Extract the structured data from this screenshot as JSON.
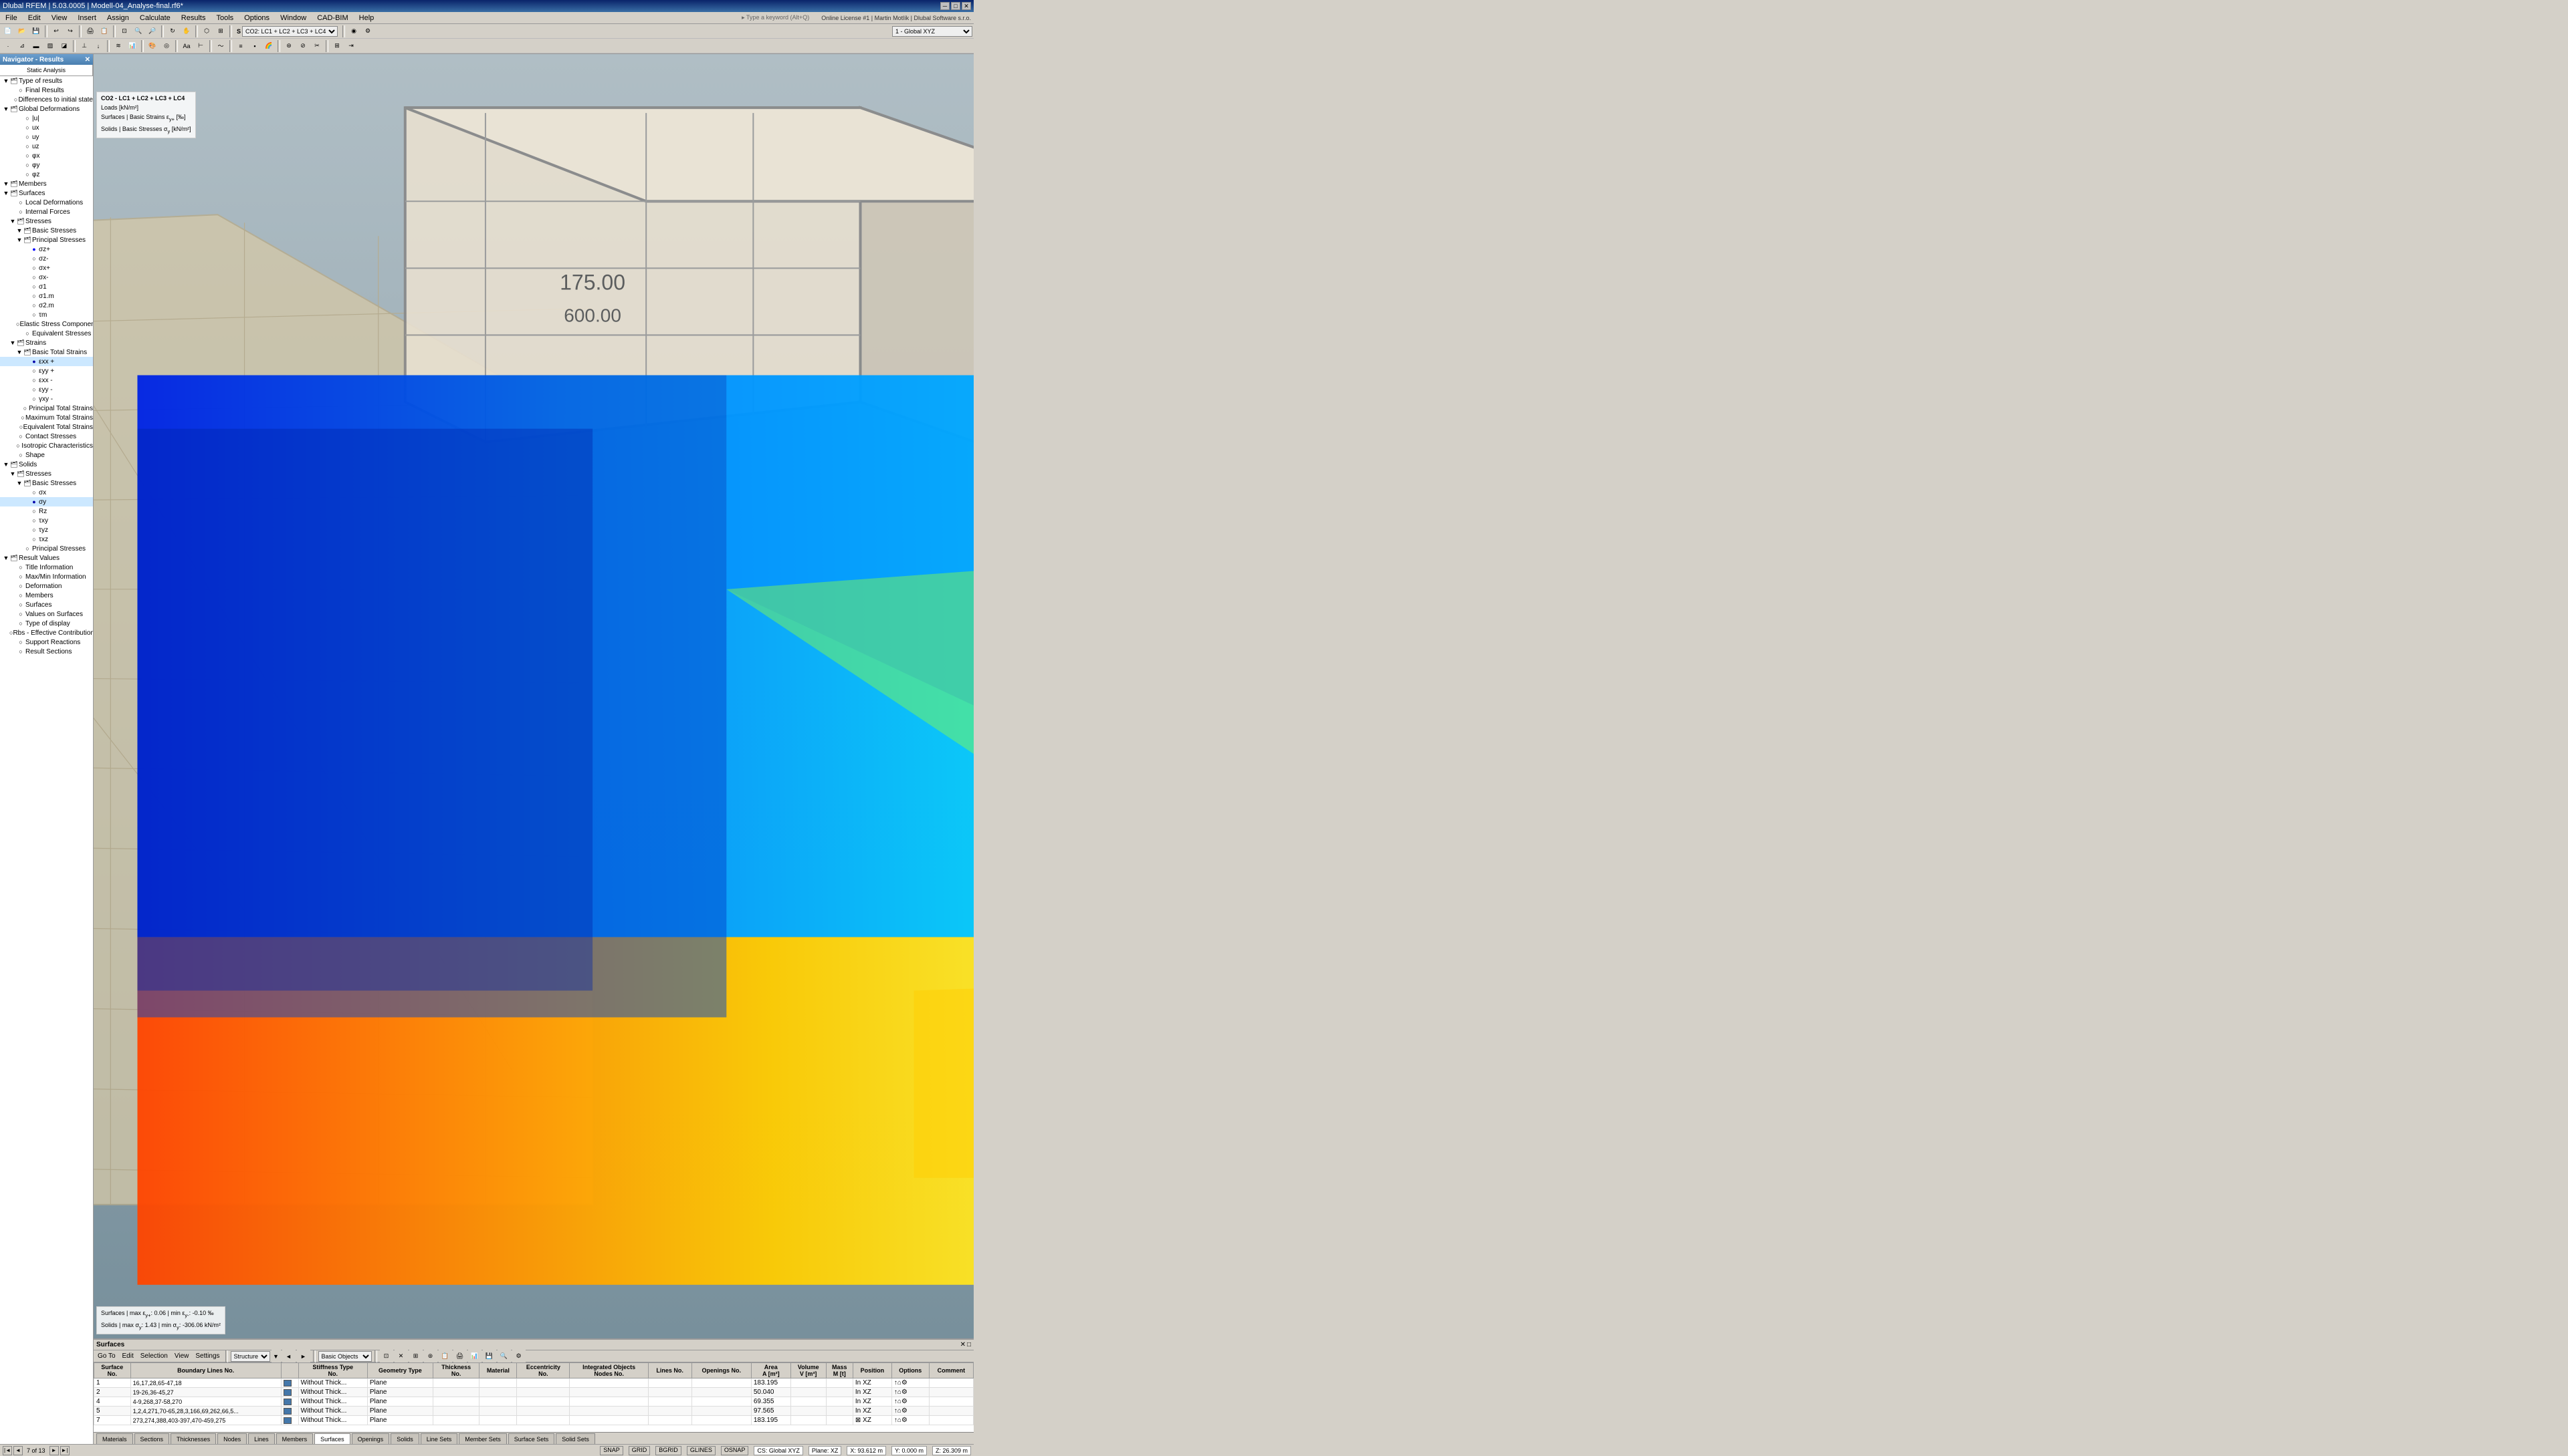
{
  "titleBar": {
    "title": "Dlubal RFEM | 5.03.0005 | Modell-04_Analyse-final.rf6*",
    "minimize": "─",
    "maximize": "□",
    "close": "✕"
  },
  "menuBar": {
    "items": [
      "File",
      "Edit",
      "View",
      "Insert",
      "Assign",
      "Calculate",
      "Results",
      "Tools",
      "Options",
      "Window",
      "CAD-BIM",
      "Help"
    ]
  },
  "navigator": {
    "title": "Navigator - Results",
    "tabs": [
      "Static Analysis"
    ],
    "tree": [
      {
        "label": "Type of results",
        "level": 0,
        "icon": "▼",
        "toggle": "▼"
      },
      {
        "label": "Final Results",
        "level": 1,
        "icon": "○",
        "toggle": ""
      },
      {
        "label": "Differences to initial state",
        "level": 1,
        "icon": "○",
        "toggle": ""
      },
      {
        "label": "Global Deformations",
        "level": 0,
        "icon": "▼",
        "toggle": "▼"
      },
      {
        "label": "|u|",
        "level": 2,
        "icon": "○",
        "toggle": ""
      },
      {
        "label": "ux",
        "level": 2,
        "icon": "○",
        "toggle": ""
      },
      {
        "label": "uy",
        "level": 2,
        "icon": "○",
        "toggle": ""
      },
      {
        "label": "uz",
        "level": 2,
        "icon": "○",
        "toggle": ""
      },
      {
        "label": "φx",
        "level": 2,
        "icon": "○",
        "toggle": ""
      },
      {
        "label": "φy",
        "level": 2,
        "icon": "○",
        "toggle": ""
      },
      {
        "label": "φz",
        "level": 2,
        "icon": "○",
        "toggle": ""
      },
      {
        "label": "Members",
        "level": 0,
        "icon": "▼",
        "toggle": "▼"
      },
      {
        "label": "Surfaces",
        "level": 0,
        "icon": "▼",
        "toggle": "▼"
      },
      {
        "label": "Local Deformations",
        "level": 1,
        "icon": "○",
        "toggle": ""
      },
      {
        "label": "Internal Forces",
        "level": 1,
        "icon": "○",
        "toggle": ""
      },
      {
        "label": "Stresses",
        "level": 1,
        "icon": "▼",
        "toggle": "▼"
      },
      {
        "label": "Basic Stresses",
        "level": 2,
        "icon": "▼",
        "toggle": "▼"
      },
      {
        "label": "Principal Stresses",
        "level": 2,
        "icon": "▼",
        "toggle": "▼"
      },
      {
        "label": "σz+",
        "level": 3,
        "icon": "●",
        "toggle": ""
      },
      {
        "label": "σz-",
        "level": 3,
        "icon": "○",
        "toggle": ""
      },
      {
        "label": "σx+",
        "level": 3,
        "icon": "○",
        "toggle": ""
      },
      {
        "label": "σx-",
        "level": 3,
        "icon": "○",
        "toggle": ""
      },
      {
        "label": "σ1",
        "level": 3,
        "icon": "○",
        "toggle": ""
      },
      {
        "label": "σ1.m",
        "level": 3,
        "icon": "○",
        "toggle": ""
      },
      {
        "label": "σ2.m",
        "level": 3,
        "icon": "○",
        "toggle": ""
      },
      {
        "label": "τm",
        "level": 3,
        "icon": "○",
        "toggle": ""
      },
      {
        "label": "Elastic Stress Components",
        "level": 2,
        "icon": "○",
        "toggle": ""
      },
      {
        "label": "Equivalent Stresses",
        "level": 2,
        "icon": "○",
        "toggle": ""
      },
      {
        "label": "Strains",
        "level": 1,
        "icon": "▼",
        "toggle": "▼"
      },
      {
        "label": "Basic Total Strains",
        "level": 2,
        "icon": "▼",
        "toggle": "▼"
      },
      {
        "label": "εxx +",
        "level": 3,
        "icon": "●",
        "toggle": ""
      },
      {
        "label": "εyy +",
        "level": 3,
        "icon": "○",
        "toggle": ""
      },
      {
        "label": "εxx -",
        "level": 3,
        "icon": "○",
        "toggle": ""
      },
      {
        "label": "εyy -",
        "level": 3,
        "icon": "○",
        "toggle": ""
      },
      {
        "label": "γxy -",
        "level": 3,
        "icon": "○",
        "toggle": ""
      },
      {
        "label": "Principal Total Strains",
        "level": 2,
        "icon": "○",
        "toggle": ""
      },
      {
        "label": "Maximum Total Strains",
        "level": 2,
        "icon": "○",
        "toggle": ""
      },
      {
        "label": "Equivalent Total Strains",
        "level": 2,
        "icon": "○",
        "toggle": ""
      },
      {
        "label": "Contact Stresses",
        "level": 1,
        "icon": "○",
        "toggle": ""
      },
      {
        "label": "Isotropic Characteristics",
        "level": 1,
        "icon": "○",
        "toggle": ""
      },
      {
        "label": "Shape",
        "level": 1,
        "icon": "○",
        "toggle": ""
      },
      {
        "label": "Solids",
        "level": 0,
        "icon": "▼",
        "toggle": "▼"
      },
      {
        "label": "Stresses",
        "level": 1,
        "icon": "▼",
        "toggle": "▼"
      },
      {
        "label": "Basic Stresses",
        "level": 2,
        "icon": "▼",
        "toggle": "▼"
      },
      {
        "label": "σx",
        "level": 3,
        "icon": "○",
        "toggle": ""
      },
      {
        "label": "σy",
        "level": 3,
        "icon": "●",
        "toggle": ""
      },
      {
        "label": "Rz",
        "level": 3,
        "icon": "○",
        "toggle": ""
      },
      {
        "label": "τxy",
        "level": 3,
        "icon": "○",
        "toggle": ""
      },
      {
        "label": "τyz",
        "level": 3,
        "icon": "○",
        "toggle": ""
      },
      {
        "label": "τxz",
        "level": 3,
        "icon": "○",
        "toggle": ""
      },
      {
        "label": "τxy",
        "level": 3,
        "icon": "○",
        "toggle": ""
      },
      {
        "label": "Principal Stresses",
        "level": 2,
        "icon": "○",
        "toggle": ""
      },
      {
        "label": "Result Values",
        "level": 0,
        "icon": "▼",
        "toggle": "▼"
      },
      {
        "label": "Title Information",
        "level": 1,
        "icon": "○",
        "toggle": ""
      },
      {
        "label": "Max/Min Information",
        "level": 1,
        "icon": "○",
        "toggle": ""
      },
      {
        "label": "Deformation",
        "level": 1,
        "icon": "○",
        "toggle": ""
      },
      {
        "label": "Members",
        "level": 1,
        "icon": "○",
        "toggle": ""
      },
      {
        "label": "Surfaces",
        "level": 1,
        "icon": "○",
        "toggle": ""
      },
      {
        "label": "Values on Surfaces",
        "level": 1,
        "icon": "○",
        "toggle": ""
      },
      {
        "label": "Type of display",
        "level": 1,
        "icon": "○",
        "toggle": ""
      },
      {
        "label": "Rbs - Effective Contribution on Surfaces...",
        "level": 1,
        "icon": "○",
        "toggle": ""
      },
      {
        "label": "Support Reactions",
        "level": 1,
        "icon": "○",
        "toggle": ""
      },
      {
        "label": "Result Sections",
        "level": 1,
        "icon": "○",
        "toggle": ""
      }
    ]
  },
  "viewport": {
    "label": "1 - Global XYZ",
    "loadCase": "CO2: LC1 + LC2 + LC3 + LC4",
    "loads": "Loads [kN/m²]",
    "result1": "Surfaces | Basic Strains εy+ [‰]",
    "result2": "Solids | Basic Stresses σy [kN/m²]"
  },
  "infoPanel": {
    "combo": "CO2 - LC1 + LC2 + LC3 + LC4",
    "loads": "Loads [kN/m²]",
    "surfaces": "Surfaces | Basic Strains εy+ [‰]",
    "solids": "Solids | Basic Stresses σy [kN/m²]"
  },
  "stressInfo": {
    "surfaces": "Surfaces | max εy+: 0.06 | min εy-: -0.10 ‰",
    "solids": "Solids | max σy: 1.43 | min σy: -306.06 kN/m²"
  },
  "resultsTable": {
    "title": "Surfaces",
    "menuItems": [
      "Go To",
      "Edit",
      "Selection",
      "View",
      "Settings"
    ],
    "columns": [
      "Surface No.",
      "Boundary Lines No.",
      "",
      "Stiffness Type No.",
      "Geometry Type",
      "Thickness No.",
      "Material",
      "Eccentricity No.",
      "Integrated Objects Nodes No.",
      "Lines No.",
      "Openings No.",
      "Area A [m²]",
      "Volume V [m³]",
      "Mass M [t]",
      "Position",
      "Options",
      "Comment"
    ],
    "rows": [
      {
        "no": "1",
        "boundaryLines": "16,17,28,65-47,18",
        "stiffnessType": "Without Thick...",
        "geometryType": "Plane",
        "thickness": "",
        "material": "",
        "eccentricity": "",
        "intNodes": "",
        "intLines": "",
        "openings": "",
        "area": "183.195",
        "volume": "",
        "mass": "",
        "position": "In XZ",
        "options": "↑⌂⚙",
        "comment": ""
      },
      {
        "no": "2",
        "boundaryLines": "19-26,36-45,27",
        "stiffnessType": "Without Thick...",
        "geometryType": "Plane",
        "thickness": "",
        "material": "",
        "eccentricity": "",
        "intNodes": "",
        "intLines": "",
        "openings": "",
        "area": "50.040",
        "volume": "",
        "mass": "",
        "position": "In XZ",
        "options": "↑⌂⚙",
        "comment": ""
      },
      {
        "no": "4",
        "boundaryLines": "4-9,268,37-58,270",
        "stiffnessType": "Without Thick...",
        "geometryType": "Plane",
        "thickness": "",
        "material": "",
        "eccentricity": "",
        "intNodes": "",
        "intLines": "",
        "openings": "",
        "area": "69.355",
        "volume": "",
        "mass": "",
        "position": "In XZ",
        "options": "↑⌂⚙",
        "comment": ""
      },
      {
        "no": "5",
        "boundaryLines": "1,2,4,271,70-65,28,3,166,69,262,66,5...",
        "stiffnessType": "Without Thick...",
        "geometryType": "Plane",
        "thickness": "",
        "material": "",
        "eccentricity": "",
        "intNodes": "",
        "intLines": "",
        "openings": "",
        "area": "97.565",
        "volume": "",
        "mass": "",
        "position": "In XZ",
        "options": "↑⌂⚙",
        "comment": ""
      },
      {
        "no": "7",
        "boundaryLines": "273,274,388,403-397,470-459,275",
        "stiffnessType": "Without Thick...",
        "geometryType": "Plane",
        "thickness": "",
        "material": "",
        "eccentricity": "",
        "intNodes": "",
        "intLines": "",
        "openings": "",
        "area": "183.195",
        "volume": "",
        "mass": "",
        "position": "⊠ XZ",
        "options": "↑⌂⚙",
        "comment": ""
      }
    ]
  },
  "bottomTabs": [
    "Materials",
    "Sections",
    "Thicknesses",
    "Nodes",
    "Lines",
    "Members",
    "Surfaces",
    "Openings",
    "Solids",
    "Line Sets",
    "Member Sets",
    "Surface Sets",
    "Solid Sets"
  ],
  "activeTab": "Surfaces",
  "statusBar": {
    "pageInfo": "7 of 13",
    "snap": "SNAP",
    "grid": "GRID",
    "bgrid": "BGRID",
    "glines": "GLINES",
    "osnap": "OSNAP",
    "cs": "CS: Global XYZ",
    "plane": "Plane: XZ",
    "x": "X: 93.612 m",
    "y": "Y: 0.000 m",
    "z": "Z: 26.309 m"
  }
}
